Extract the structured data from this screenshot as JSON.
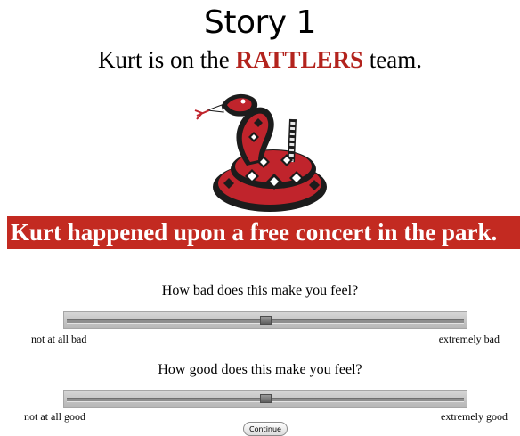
{
  "story": {
    "title": "Story 1",
    "team_prefix": "Kurt is on the ",
    "team_name": "RATTLERS",
    "team_suffix": " team.",
    "event_text": "Kurt happened upon a free concert in the park."
  },
  "colors": {
    "team_red": "#b3231d",
    "banner_red": "#c32a21"
  },
  "image": {
    "icon": "rattlesnake-logo"
  },
  "sliders": [
    {
      "question": "How bad does this make you feel?",
      "min_label": "not at all bad",
      "max_label": "extremely bad",
      "value": 0.5
    },
    {
      "question": "How good does this make you feel?",
      "min_label": "not at all good",
      "max_label": "extremely good",
      "value": 0.5
    }
  ],
  "continue_label": "Continue"
}
